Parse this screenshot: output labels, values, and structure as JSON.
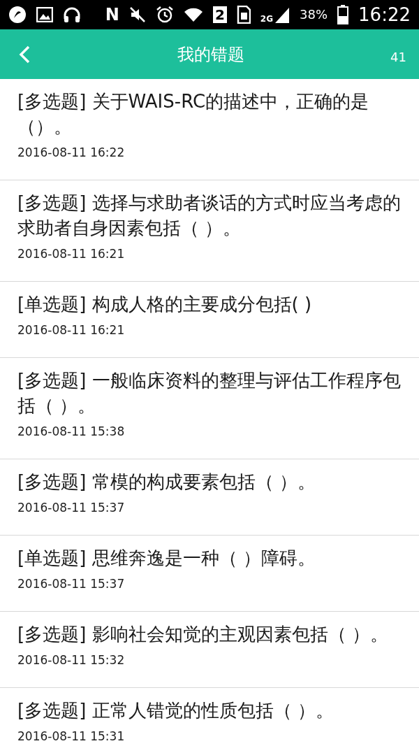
{
  "status_bar": {
    "network_letter": "N",
    "sim_slot": "2",
    "network_type": "2G",
    "battery": "38%",
    "time": "16:22"
  },
  "header": {
    "title": "我的错题",
    "count": "41"
  },
  "items": [
    {
      "title": "[多选题] 关于WAIS-RC的描述中，正确的是（）。",
      "date": "2016-08-11 16:22"
    },
    {
      "title": "[多选题] 选择与求助者谈话的方式时应当考虑的求助者自身因素包括（ ）。",
      "date": "2016-08-11 16:21"
    },
    {
      "title": "[单选题] 构成人格的主要成分包括( )",
      "date": "2016-08-11 16:21"
    },
    {
      "title": "[多选题] 一般临床资料的整理与评估工作程序包括（ ）。",
      "date": "2016-08-11 15:38"
    },
    {
      "title": "[多选题] 常模的构成要素包括（ ）。",
      "date": "2016-08-11 15:37"
    },
    {
      "title": "[单选题] 思维奔逸是一种（ ）障碍。",
      "date": "2016-08-11 15:37"
    },
    {
      "title": "[多选题] 影响社会知觉的主观因素包括（ ）。",
      "date": "2016-08-11 15:32"
    },
    {
      "title": "[多选题] 正常人错觉的性质包括（ ）。",
      "date": "2016-08-11 15:31"
    }
  ]
}
